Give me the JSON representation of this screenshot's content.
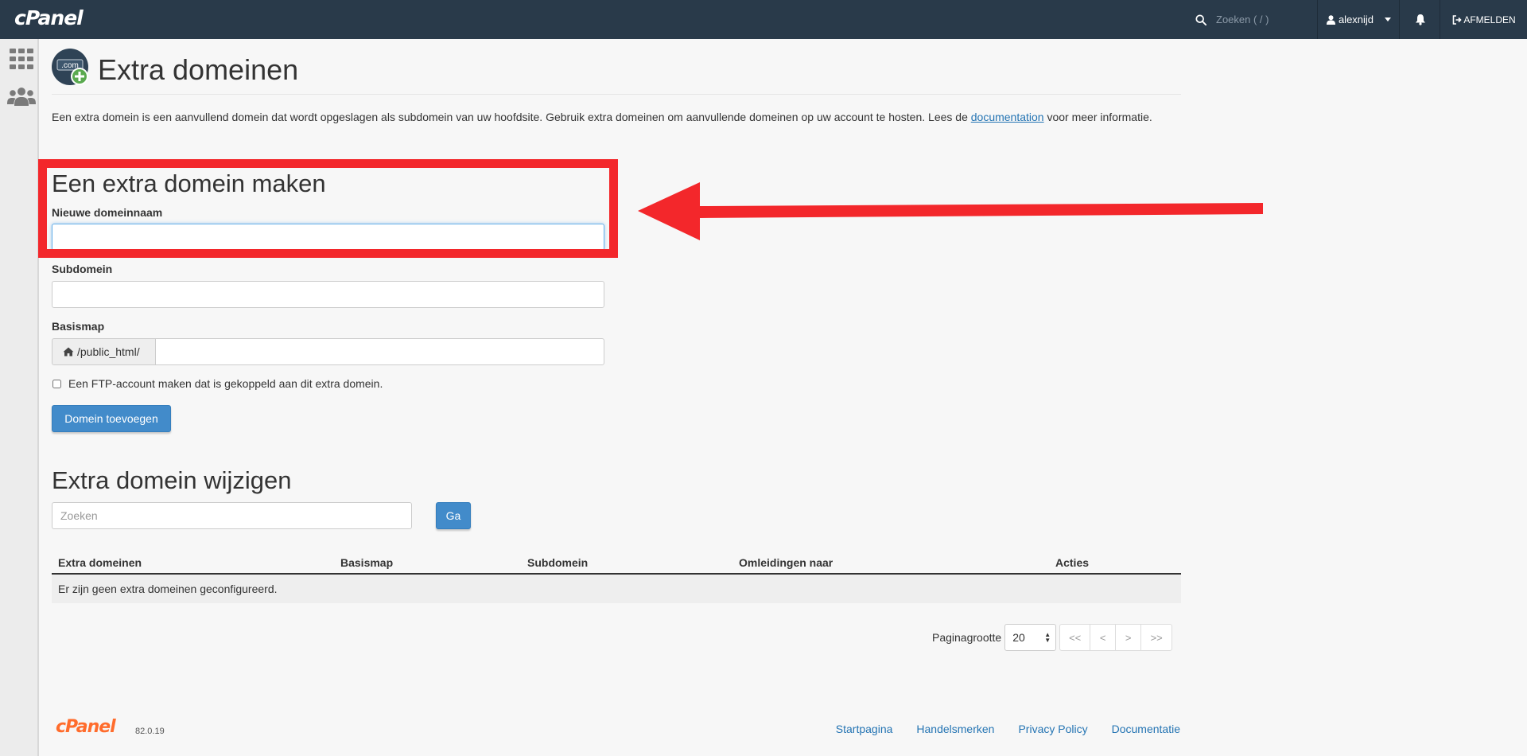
{
  "topbar": {
    "logo": "cPanel",
    "search_placeholder": "Zoeken ( / )",
    "username": "alexnijd",
    "logout_label": "AFMELDEN"
  },
  "page": {
    "title": "Extra domeinen",
    "icon_text": ".com",
    "intro_text": "Een extra domein is een aanvullend domein dat wordt opgeslagen als subdomein van uw hoofdsite. Gebruik extra domeinen om aanvullende domeinen op uw account te hosten. Lees de ",
    "intro_link": "documentation",
    "intro_text_end": " voor meer informatie."
  },
  "create_form": {
    "heading": "Een extra domein maken",
    "new_domain_label": "Nieuwe domeinnaam",
    "new_domain_value": "",
    "subdomain_label": "Subdomein",
    "subdomain_value": "",
    "docroot_label": "Basismap",
    "docroot_prefix": "/public_html/",
    "docroot_value": "",
    "ftp_checkbox_label": "Een FTP-account maken dat is gekoppeld aan dit extra domein.",
    "ftp_checked": false,
    "submit_label": "Domein toevoegen"
  },
  "modify_section": {
    "heading": "Extra domein wijzigen",
    "search_placeholder": "Zoeken",
    "go_label": "Ga",
    "table": {
      "columns": [
        "Extra domeinen",
        "Basismap",
        "Subdomein",
        "Omleidingen naar",
        "Acties"
      ],
      "empty_message": "Er zijn geen extra domeinen geconfigureerd."
    },
    "pagination": {
      "page_size_label": "Paginagrootte",
      "page_size_value": "20",
      "first": "<<",
      "prev": "<",
      "next": ">",
      "last": ">>"
    }
  },
  "footer": {
    "logo": "cPanel",
    "version": "82.0.19",
    "links": [
      "Startpagina",
      "Handelsmerken",
      "Privacy Policy",
      "Documentatie"
    ]
  },
  "colors": {
    "topbar_bg": "#293a4a",
    "primary_button": "#428bca",
    "link": "#2474b3",
    "annotation_red": "#f3272b",
    "footer_logo": "#ff6c2c"
  }
}
